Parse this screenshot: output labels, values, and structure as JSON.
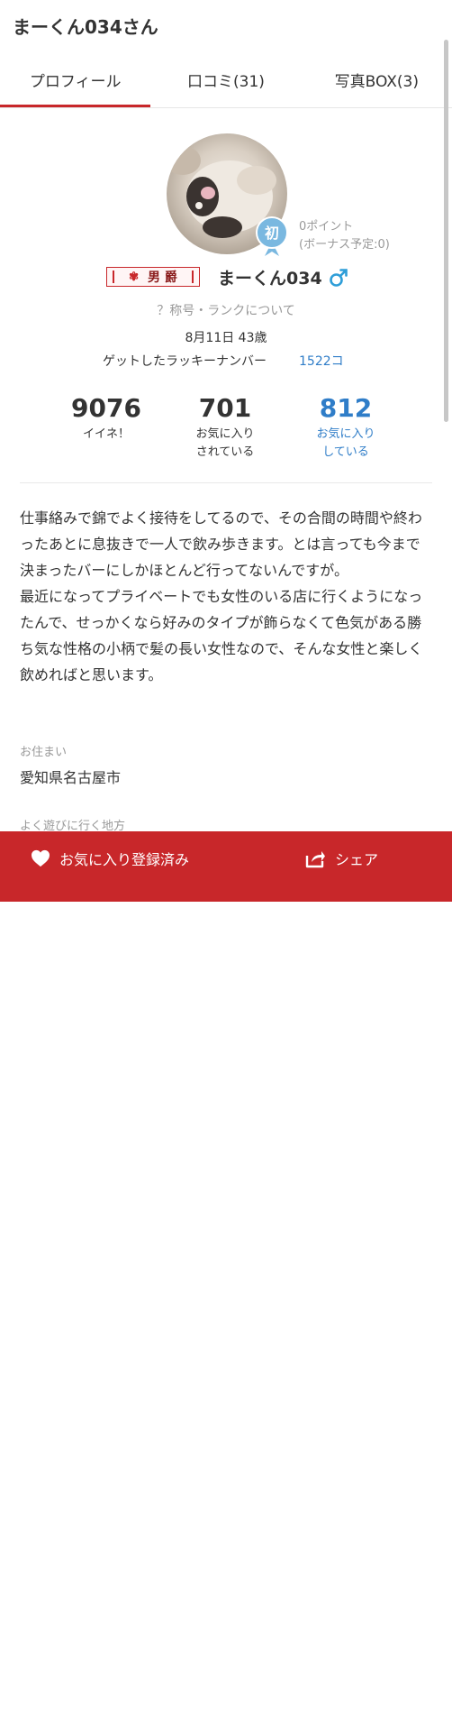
{
  "header": {
    "title": "まーくん034さん"
  },
  "tabs": [
    {
      "label": "プロフィール",
      "active": true
    },
    {
      "label": "口コミ(31)",
      "active": false
    },
    {
      "label": "写真BOX(3)",
      "active": false
    }
  ],
  "profile": {
    "badge_char": "初",
    "points_line1": "0ポイント",
    "points_line2": "(ボーナス予定:0)",
    "rank_title": "男 爵",
    "username": "まーくん034",
    "gender_icon": "male-icon",
    "rank_help": "？称号・ランクについて",
    "birthday_age": "8月11日 43歳",
    "lucky_label": "ゲットしたラッキーナンバー",
    "lucky_value": "1522コ"
  },
  "stats": [
    {
      "value": "9076",
      "label1": "イイネ！",
      "label2": ""
    },
    {
      "value": "701",
      "label1": "お気に入り",
      "label2": "されている"
    },
    {
      "value": "812",
      "label1": "お気に入り",
      "label2": "している"
    }
  ],
  "bio": "仕事絡みで錦でよく接待をしてるので、その合間の時間や終わったあとに息抜きで一人で飲み歩きます。とは言っても今まで決まったバーにしかほとんど行ってないんですが。\n最近になってプライベートでも女性のいる店に行くようになったんで、せっかくなら好みのタイプが飾らなくて色気がある勝ち気な性格の小柄で髪の長い女性なので、そんな女性と楽しく飲めればと思います。",
  "residence": {
    "label": "お住まい",
    "value": "愛知県名古屋市"
  },
  "area": {
    "label": "よく遊びに行く地方"
  },
  "bottom_bar": {
    "favorite_label": "お気に入り登録済み",
    "share_label": "シェア"
  },
  "colors": {
    "accent": "#c8272a",
    "link": "#2f7dc8",
    "badge": "#7ab8e0"
  }
}
